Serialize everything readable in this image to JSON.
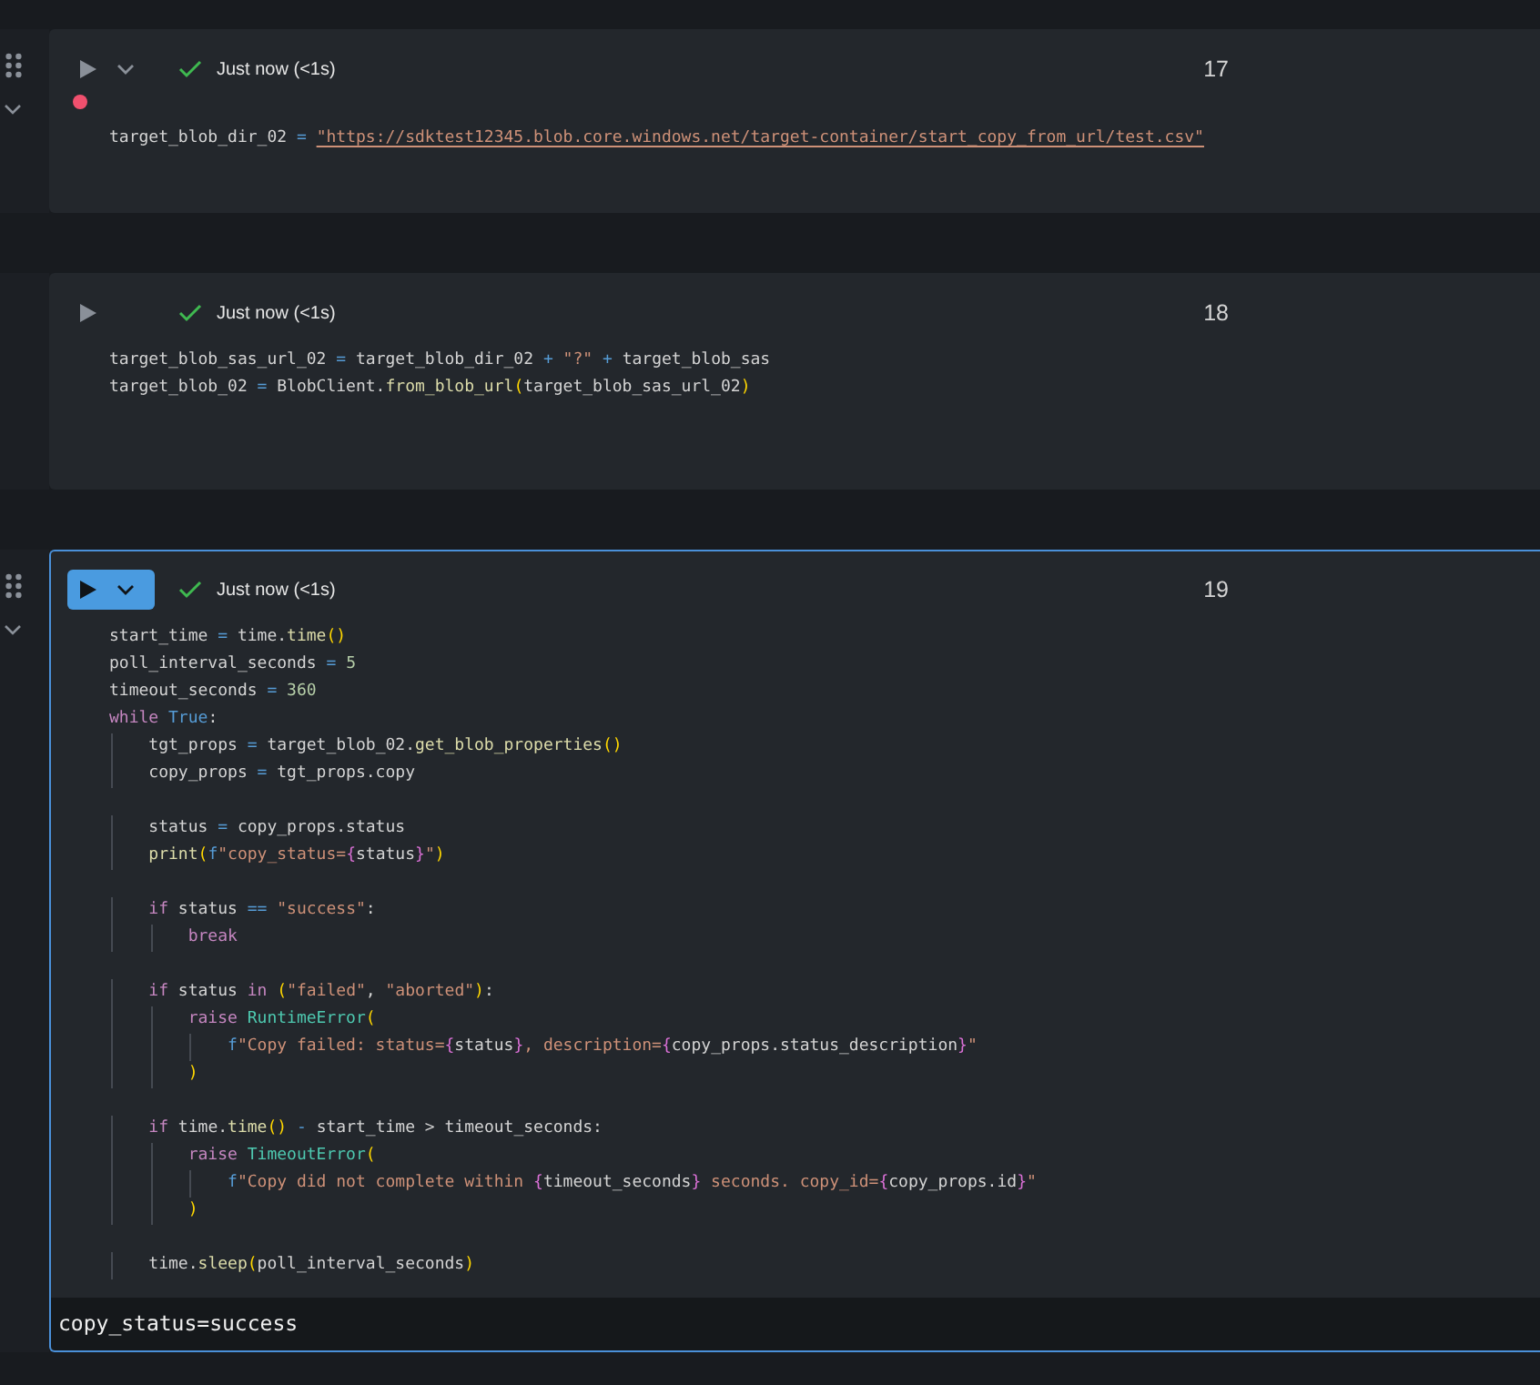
{
  "cells": [
    {
      "hovered": true,
      "selected": false,
      "has_run_menu": true,
      "modified": true,
      "status": "Just now (<1s)",
      "execution_count": "17",
      "lines": [
        {
          "kind": "code",
          "tokens": [
            {
              "text": "target_blob_dir_02",
              "kind": "v"
            },
            {
              "text": " = ",
              "kind": "o"
            },
            {
              "text": "\"https://sdktest12345.blob.core.windows.net/target-container/start_copy_from_url/test.csv\"",
              "kind": "url"
            }
          ]
        }
      ]
    },
    {
      "hovered": false,
      "selected": false,
      "has_run_menu": false,
      "modified": false,
      "status": "Just now (<1s)",
      "execution_count": "18",
      "lines": [
        {
          "kind": "code",
          "tokens": [
            {
              "text": "target_blob_sas_url_02",
              "kind": "v"
            },
            {
              "text": " = ",
              "kind": "o"
            },
            {
              "text": "target_blob_dir_02",
              "kind": "v"
            },
            {
              "text": " + ",
              "kind": "o"
            },
            {
              "text": "\"?\"",
              "kind": "s"
            },
            {
              "text": " + ",
              "kind": "o"
            },
            {
              "text": "target_blob_sas",
              "kind": "v"
            }
          ]
        },
        {
          "kind": "code",
          "tokens": [
            {
              "text": "target_blob_02",
              "kind": "v"
            },
            {
              "text": " = ",
              "kind": "o"
            },
            {
              "text": "BlobClient.",
              "kind": "v"
            },
            {
              "text": "from_blob_url",
              "kind": "f"
            },
            {
              "text": "(",
              "kind": "p"
            },
            {
              "text": "target_blob_sas_url_02",
              "kind": "v"
            },
            {
              "text": ")",
              "kind": "p"
            }
          ]
        },
        {
          "kind": "blank"
        }
      ]
    },
    {
      "hovered": true,
      "selected": true,
      "has_run_menu": true,
      "modified": false,
      "status": "Just now (<1s)",
      "execution_count": "19",
      "output": "copy_status=success",
      "lines": [
        {
          "kind": "code",
          "tokens": [
            {
              "text": "start_time",
              "kind": "v"
            },
            {
              "text": " = ",
              "kind": "o"
            },
            {
              "text": "time.",
              "kind": "v"
            },
            {
              "text": "time",
              "kind": "f"
            },
            {
              "text": "()",
              "kind": "p"
            }
          ]
        },
        {
          "kind": "code",
          "tokens": [
            {
              "text": "poll_interval_seconds",
              "kind": "v"
            },
            {
              "text": " = ",
              "kind": "o"
            },
            {
              "text": "5",
              "kind": "n"
            }
          ]
        },
        {
          "kind": "code",
          "tokens": [
            {
              "text": "timeout_seconds",
              "kind": "v"
            },
            {
              "text": " = ",
              "kind": "o"
            },
            {
              "text": "360",
              "kind": "n"
            }
          ]
        },
        {
          "kind": "code",
          "tokens": [
            {
              "text": "while ",
              "kind": "k"
            },
            {
              "text": "True",
              "kind": "c"
            },
            {
              "text": ":",
              "kind": "v"
            }
          ]
        },
        {
          "kind": "code",
          "tokens": [
            {
              "text": "    tgt_props",
              "kind": "v"
            },
            {
              "text": " = ",
              "kind": "o"
            },
            {
              "text": "target_blob_02.",
              "kind": "v"
            },
            {
              "text": "get_blob_properties",
              "kind": "f"
            },
            {
              "text": "()",
              "kind": "p"
            }
          ]
        },
        {
          "kind": "code",
          "tokens": [
            {
              "text": "    copy_props",
              "kind": "v"
            },
            {
              "text": " = ",
              "kind": "o"
            },
            {
              "text": "tgt_props.copy",
              "kind": "v"
            }
          ]
        },
        {
          "kind": "blank"
        },
        {
          "kind": "code",
          "tokens": [
            {
              "text": "    status",
              "kind": "v"
            },
            {
              "text": " = ",
              "kind": "o"
            },
            {
              "text": "copy_props.status",
              "kind": "v"
            }
          ]
        },
        {
          "kind": "code",
          "tokens": [
            {
              "text": "    print",
              "kind": "f"
            },
            {
              "text": "(",
              "kind": "p"
            },
            {
              "text": "f",
              "kind": "pf"
            },
            {
              "text": "\"copy_status=",
              "kind": "s"
            },
            {
              "text": "{",
              "kind": "b"
            },
            {
              "text": "status",
              "kind": "v"
            },
            {
              "text": "}",
              "kind": "b"
            },
            {
              "text": "\"",
              "kind": "s"
            },
            {
              "text": ")",
              "kind": "p"
            }
          ]
        },
        {
          "kind": "blank"
        },
        {
          "kind": "code",
          "tokens": [
            {
              "text": "    if",
              "kind": "k"
            },
            {
              "text": " status ",
              "kind": "v"
            },
            {
              "text": "== ",
              "kind": "o"
            },
            {
              "text": "\"success\"",
              "kind": "s"
            },
            {
              "text": ":",
              "kind": "v"
            }
          ]
        },
        {
          "kind": "code",
          "tokens": [
            {
              "text": "        break",
              "kind": "k"
            }
          ]
        },
        {
          "kind": "blank"
        },
        {
          "kind": "code",
          "tokens": [
            {
              "text": "    if",
              "kind": "k"
            },
            {
              "text": " status ",
              "kind": "v"
            },
            {
              "text": "in ",
              "kind": "k"
            },
            {
              "text": "(",
              "kind": "p"
            },
            {
              "text": "\"failed\"",
              "kind": "s"
            },
            {
              "text": ", ",
              "kind": "v"
            },
            {
              "text": "\"aborted\"",
              "kind": "s"
            },
            {
              "text": ")",
              "kind": "p"
            },
            {
              "text": ":",
              "kind": "v"
            }
          ]
        },
        {
          "kind": "code",
          "tokens": [
            {
              "text": "        raise ",
              "kind": "k"
            },
            {
              "text": "RuntimeError",
              "kind": "cls"
            },
            {
              "text": "(",
              "kind": "p"
            }
          ]
        },
        {
          "kind": "code",
          "tokens": [
            {
              "text": "            f",
              "kind": "pf"
            },
            {
              "text": "\"Copy failed: status=",
              "kind": "s"
            },
            {
              "text": "{",
              "kind": "b"
            },
            {
              "text": "status",
              "kind": "v"
            },
            {
              "text": "}",
              "kind": "b"
            },
            {
              "text": ", description=",
              "kind": "s"
            },
            {
              "text": "{",
              "kind": "b"
            },
            {
              "text": "copy_props.status_description",
              "kind": "v"
            },
            {
              "text": "}",
              "kind": "b"
            },
            {
              "text": "\"",
              "kind": "s"
            }
          ]
        },
        {
          "kind": "code",
          "tokens": [
            {
              "text": "        )",
              "kind": "p"
            }
          ]
        },
        {
          "kind": "blank"
        },
        {
          "kind": "code",
          "tokens": [
            {
              "text": "    if",
              "kind": "k"
            },
            {
              "text": " time.",
              "kind": "v"
            },
            {
              "text": "time",
              "kind": "f"
            },
            {
              "text": "()",
              "kind": "p"
            },
            {
              "text": " - ",
              "kind": "o"
            },
            {
              "text": "start_time > timeout_seconds:",
              "kind": "v"
            }
          ]
        },
        {
          "kind": "code",
          "tokens": [
            {
              "text": "        raise ",
              "kind": "k"
            },
            {
              "text": "TimeoutError",
              "kind": "cls"
            },
            {
              "text": "(",
              "kind": "p"
            }
          ]
        },
        {
          "kind": "code",
          "tokens": [
            {
              "text": "            f",
              "kind": "pf"
            },
            {
              "text": "\"Copy did not complete within ",
              "kind": "s"
            },
            {
              "text": "{",
              "kind": "b"
            },
            {
              "text": "timeout_seconds",
              "kind": "v"
            },
            {
              "text": "}",
              "kind": "b"
            },
            {
              "text": " seconds. copy_id=",
              "kind": "s"
            },
            {
              "text": "{",
              "kind": "b"
            },
            {
              "text": "copy_props.id",
              "kind": "v"
            },
            {
              "text": "}",
              "kind": "b"
            },
            {
              "text": "\"",
              "kind": "s"
            }
          ]
        },
        {
          "kind": "code",
          "tokens": [
            {
              "text": "        )",
              "kind": "p"
            }
          ]
        },
        {
          "kind": "blank"
        },
        {
          "kind": "code",
          "tokens": [
            {
              "text": "    time.",
              "kind": "v"
            },
            {
              "text": "sleep",
              "kind": "f"
            },
            {
              "text": "(",
              "kind": "p"
            },
            {
              "text": "poll_interval_seconds",
              "kind": "v"
            },
            {
              "text": ")",
              "kind": "p"
            }
          ]
        }
      ]
    }
  ]
}
